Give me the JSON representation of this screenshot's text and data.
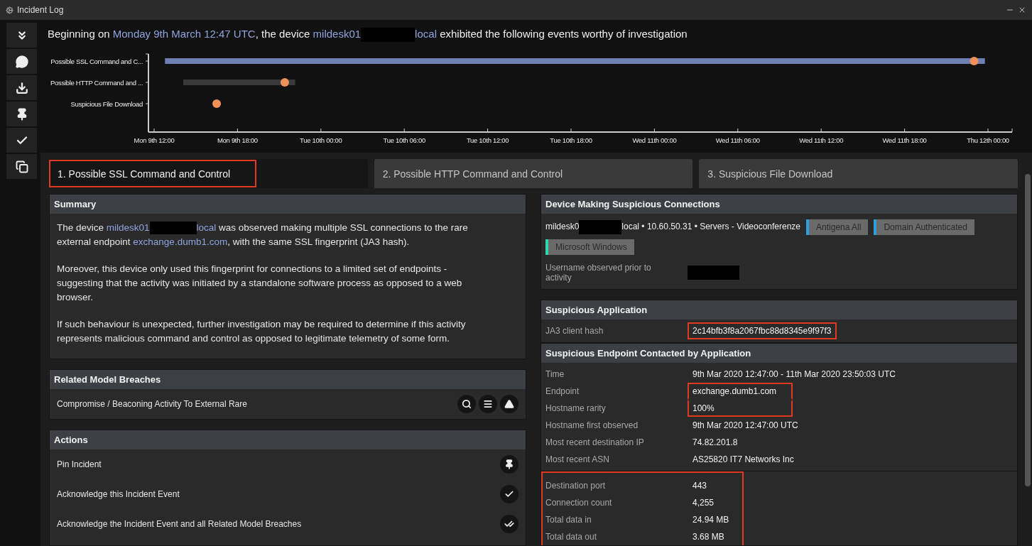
{
  "window": {
    "title": "Incident Log"
  },
  "sidebar": {
    "items": [
      {
        "kind": "collapse"
      },
      {
        "kind": "comment"
      },
      {
        "kind": "download"
      },
      {
        "kind": "pin"
      },
      {
        "kind": "acknowledge"
      },
      {
        "kind": "copy"
      }
    ]
  },
  "headline": [
    {
      "kind": "text",
      "text": "Beginning on "
    },
    {
      "kind": "link",
      "text": "Monday 9th March 12:47 UTC"
    },
    {
      "kind": "text",
      "text": ", the device "
    },
    {
      "kind": "link",
      "text": "mildesk01"
    },
    {
      "kind": "redacted"
    },
    {
      "kind": "link",
      "text": "local"
    },
    {
      "kind": "text",
      "text": " exhibited the following events worthy of investigation"
    }
  ],
  "timeline": {
    "rows": [
      {
        "label": "Possible SSL Command and C...",
        "color": "#6d7fb3"
      },
      {
        "label": "Possible HTTP Command and ...",
        "color": "#3a3a3a"
      },
      {
        "label": "Suspicious File Download"
      }
    ],
    "ticks": [
      "Mon 9th 12:00",
      "Mon 9th 18:00",
      "Tue 10th 00:00",
      "Tue 10th 06:00",
      "Tue 10th 12:00",
      "Tue 10th 18:00",
      "Wed 11th 00:00",
      "Wed 11th 06:00",
      "Wed 11th 12:00",
      "Wed 11th 18:00",
      "Thu 12th 00:00"
    ]
  },
  "tabs": [
    {
      "label": "1. Possible SSL Command and Control",
      "selected": true,
      "highlighted": true
    },
    {
      "label": "2. Possible HTTP Command and Control",
      "selected": false,
      "highlighted": false
    },
    {
      "label": "3. Suspicious File Download",
      "selected": false,
      "highlighted": false
    }
  ],
  "summary": {
    "title": "Summary",
    "paragraphs": [
      [
        {
          "kind": "text",
          "text": "The device "
        },
        {
          "kind": "link",
          "text": "mildesk01"
        },
        {
          "kind": "redacted"
        },
        {
          "kind": "link",
          "text": "local"
        },
        {
          "kind": "text",
          "text": " was observed making multiple SSL connections to the rare external endpoint "
        },
        {
          "kind": "link",
          "text": "exchange.dumb1.com"
        },
        {
          "kind": "text",
          "text": ", with the same SSL fingerprint (JA3 hash)."
        }
      ],
      [
        {
          "kind": "text",
          "text": "Moreover, this device only used this fingerprint for connections to a limited set of endpoints - suggesting that the activity was initiated by a standalone software process as opposed to a web browser."
        }
      ],
      [
        {
          "kind": "text",
          "text": "If such behaviour is unexpected, further investigation may be required to determine if this activity represents malicious command and control as opposed to legitimate telemetry of some form."
        }
      ]
    ]
  },
  "breaches": {
    "title": "Related Model Breaches",
    "items": [
      {
        "name": "Compromise / Beaconing Activity To External Rare",
        "actions": [
          {
            "kind": "search"
          },
          {
            "kind": "list"
          },
          {
            "kind": "warning"
          }
        ]
      }
    ]
  },
  "actions": {
    "title": "Actions",
    "items": [
      {
        "label": "Pin Incident",
        "kind": "pin"
      },
      {
        "label": "Acknowledge this Incident Event",
        "kind": "check"
      },
      {
        "label": "Acknowledge the Incident Event and all Related Model Breaches",
        "kind": "double-check"
      }
    ]
  },
  "device": {
    "title": "Device Making Suspicious Connections",
    "line": [
      {
        "kind": "text",
        "text": "mildesk0"
      },
      {
        "kind": "redacted"
      },
      {
        "kind": "text",
        "text": "local • 10.60.50.31 • Servers - Videoconferenze"
      }
    ],
    "tags": [
      {
        "label": "Antigena All",
        "color": "#2a9fd8"
      },
      {
        "label": "Domain Authenticated",
        "color": "#2a9fd8"
      },
      {
        "label": "Microsoft Windows",
        "color": "#2fd6b0"
      }
    ],
    "username_label": "Username observed prior to activity"
  },
  "application": {
    "title": "Suspicious Application",
    "rows": [
      {
        "label": "JA3 client hash",
        "value": "2c14bfb3f8a2067fbc88d8345e9f97f3",
        "highlighted": true
      }
    ]
  },
  "endpoint": {
    "title": "Suspicious Endpoint Contacted by Application",
    "rows": [
      {
        "label": "Time",
        "value": "9th Mar 2020 12:47:00 - 11th Mar 2020 23:50:03 UTC",
        "highlighted": false
      },
      {
        "label": "Endpoint",
        "value": "exchange.dumb1.com",
        "highlighted": true
      },
      {
        "label": "Hostname rarity",
        "value": "100%",
        "highlighted": true
      },
      {
        "label": "Hostname first observed",
        "value": "9th Mar 2020 12:47:00 UTC",
        "highlighted": false
      },
      {
        "label": "Most recent destination IP",
        "value": "74.82.201.8",
        "highlighted": false
      },
      {
        "label": "Most recent ASN",
        "value": "AS25820 IT7 Networks Inc",
        "highlighted": false
      }
    ],
    "stats": {
      "highlighted": true,
      "rows": [
        {
          "label": "Destination port",
          "value": "443"
        },
        {
          "label": "Connection count",
          "value": "4,255"
        },
        {
          "label": "Total data in",
          "value": "24.94 MB"
        },
        {
          "label": "Total data out",
          "value": "3.68 MB"
        }
      ]
    }
  }
}
